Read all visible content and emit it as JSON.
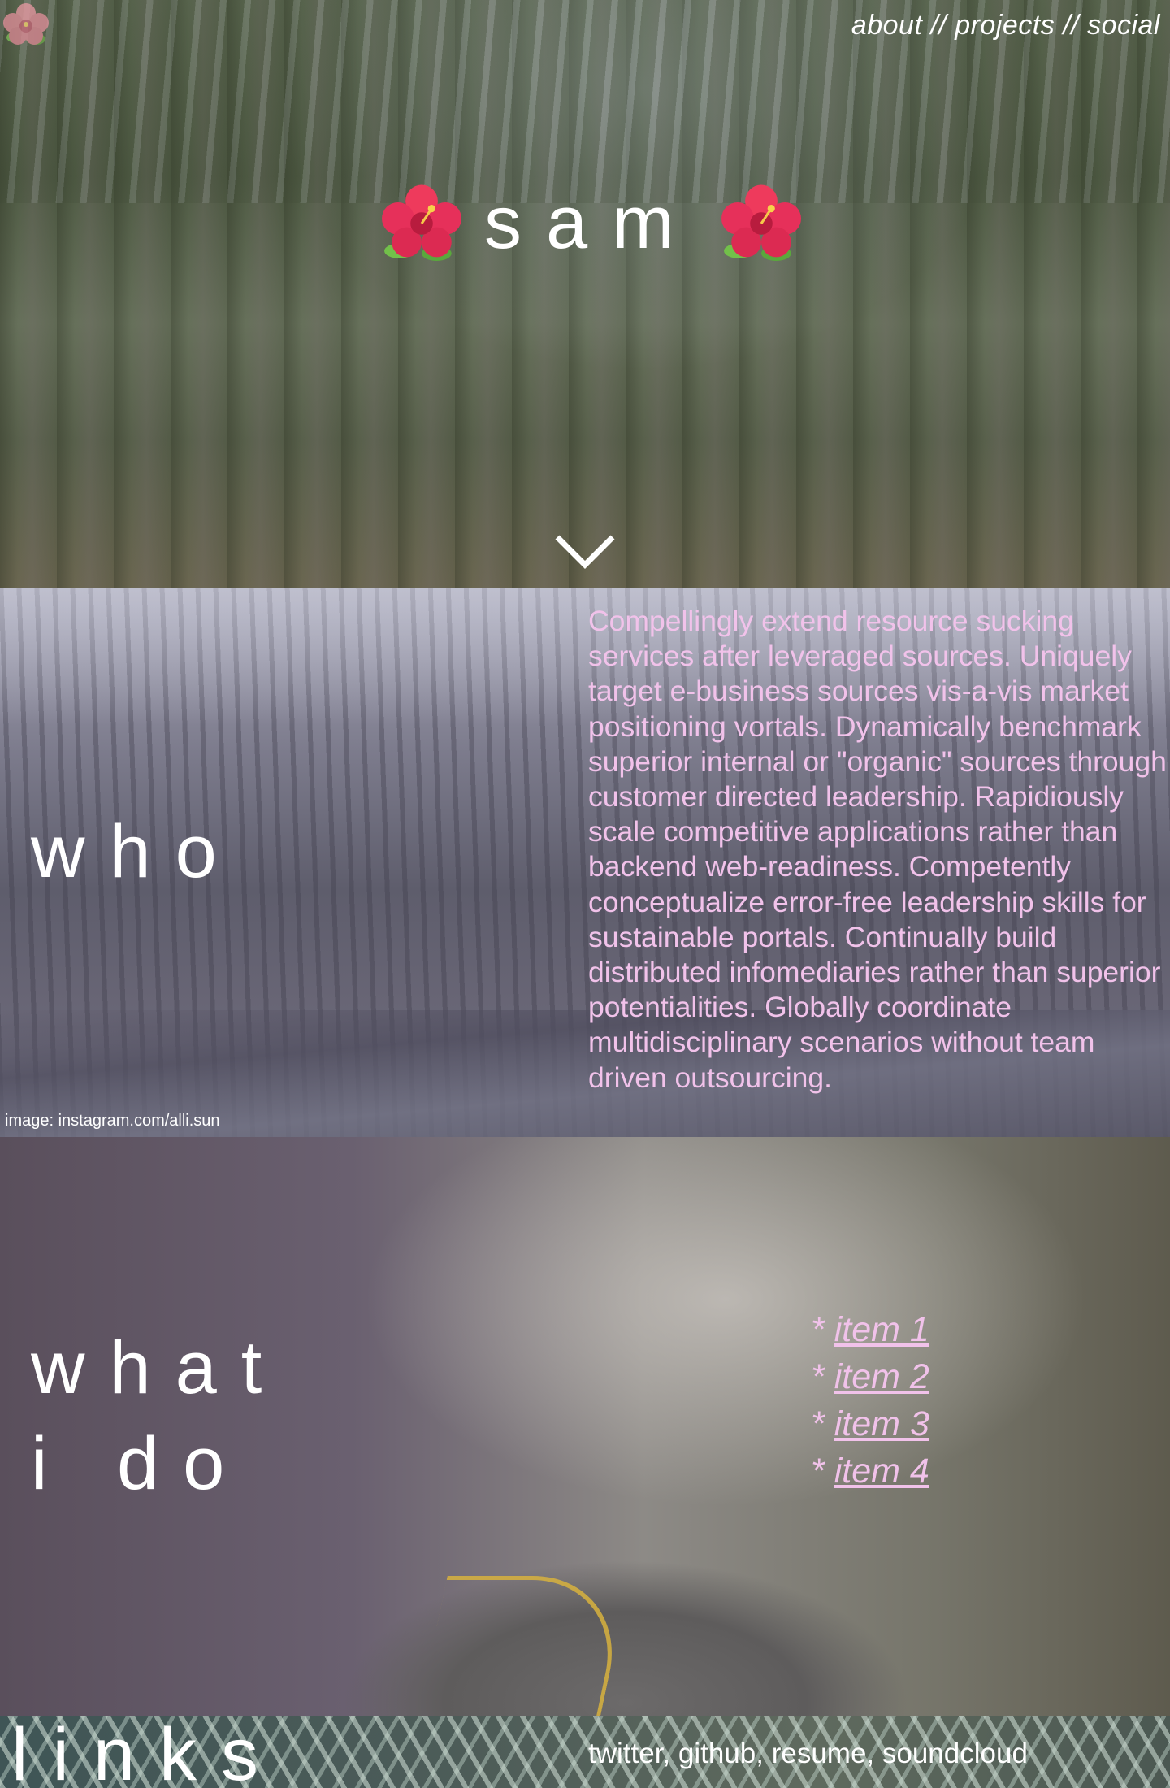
{
  "nav": {
    "about": "about",
    "projects": "projects",
    "social": "social",
    "sep": " // "
  },
  "hero": {
    "title": "sam"
  },
  "who": {
    "title": "who",
    "bio": "Compellingly extend resource sucking services after leveraged sources. Uniquely target e-business sources vis-a-vis market positioning vortals. Dynamically benchmark superior internal or \"organic\" sources through customer directed leadership. Rapidiously scale competitive applications rather than backend web-readiness. Competently conceptualize error-free leadership skills for sustainable portals. Continually build distributed infomediaries rather than superior potentialities. Globally coordinate multidisciplinary scenarios without team driven outsourcing.",
    "credit": "image: instagram.com/alli.sun"
  },
  "what": {
    "title_line1": "what",
    "title_line2": "i do",
    "items": [
      "item 1",
      "item 2",
      "item 3",
      "item 4"
    ],
    "bullet": "* "
  },
  "links": {
    "title": "links",
    "items": [
      "twitter",
      "github",
      "resume",
      "soundcloud"
    ],
    "sep": ", "
  },
  "colors": {
    "accent_pink": "#f1c2ea",
    "text_white": "#ffffff"
  },
  "icons": {
    "logo": "hibiscus-icon",
    "scroll": "chevron-down-icon"
  }
}
